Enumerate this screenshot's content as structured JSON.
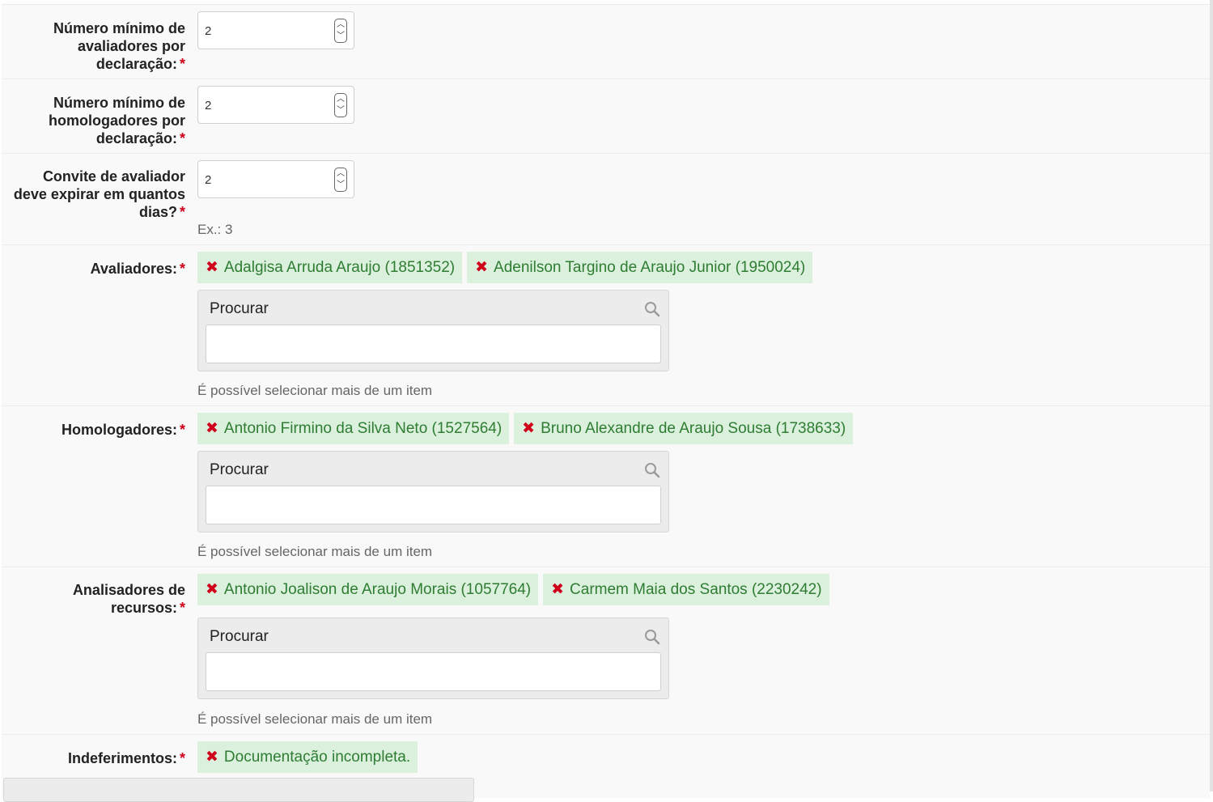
{
  "fields": {
    "min_evaluators": {
      "label_lines": [
        "Número mínimo de",
        "avaliadores por",
        "declaração:"
      ],
      "value": "2"
    },
    "min_approvers": {
      "label_lines": [
        "Número mínimo de",
        "homologadores por",
        "declaração:"
      ],
      "value": "2"
    },
    "invite_expiry": {
      "label_lines": [
        "Convite de avaliador",
        "deve expirar em quantos",
        "dias?"
      ],
      "value": "2",
      "help": "Ex.: 3"
    },
    "evaluators": {
      "label": "Avaliadores:",
      "chips": [
        "Adalgisa Arruda Araujo (1851352)",
        "Adenilson Targino de Araujo Junior (1950024)"
      ],
      "search_label": "Procurar",
      "help": "É possível selecionar mais de um item"
    },
    "approvers": {
      "label": "Homologadores:",
      "chips": [
        "Antonio Firmino da Silva Neto (1527564)",
        "Bruno Alexandre de Araujo Sousa (1738633)"
      ],
      "search_label": "Procurar",
      "help": "É possível selecionar mais de um item"
    },
    "appeal_analysts": {
      "label_lines": [
        "Analisadores de",
        "recursos:"
      ],
      "chips": [
        "Antonio Joalison de Araujo Morais (1057764)",
        "Carmem Maia dos Santos (2230242)"
      ],
      "search_label": "Procurar",
      "help": "É possível selecionar mais de um item"
    },
    "rejections": {
      "label": "Indeferimentos:",
      "chips": [
        "Documentação incompleta."
      ]
    }
  },
  "required_mark": "*",
  "remove_icon": "✖",
  "colors": {
    "chip_bg": "#dbf0dd",
    "chip_text": "#2e7d32",
    "required": "#d0021b",
    "remove": "#d0021b"
  }
}
